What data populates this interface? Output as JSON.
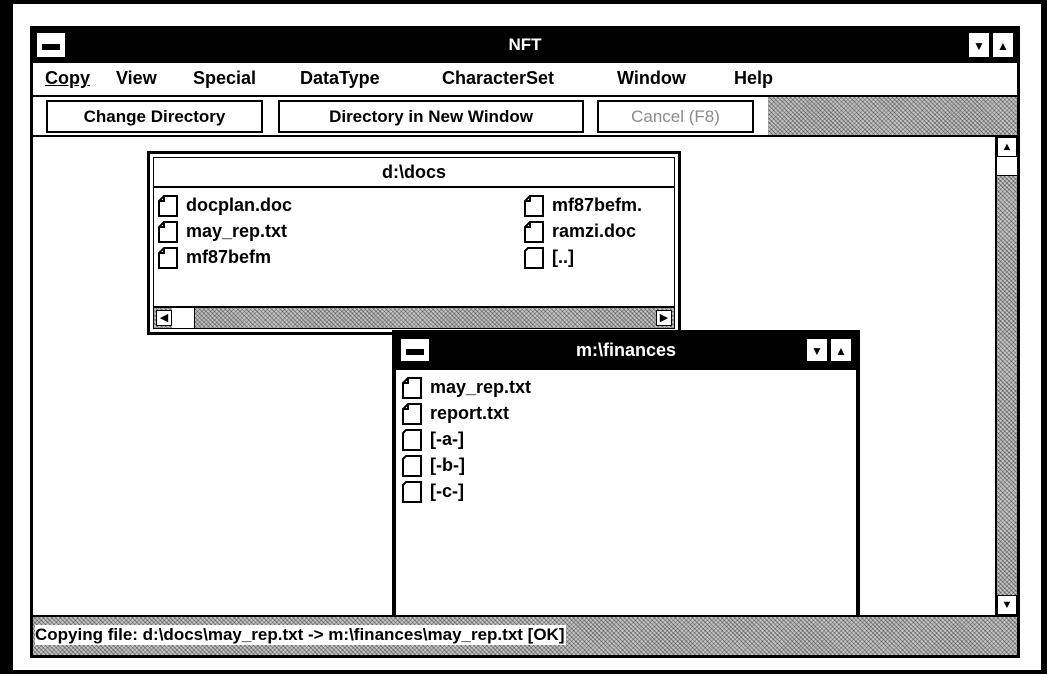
{
  "app": {
    "title": "NFT",
    "menu": [
      "Copy",
      "View",
      "Special",
      "DataType",
      "CharacterSet",
      "Window",
      "Help"
    ],
    "toolbar": {
      "change_directory": "Change Directory",
      "directory_new_window": "Directory in New Window",
      "cancel": "Cancel (F8)"
    },
    "status": "Copying file: d:\\docs\\may_rep.txt -> m:\\finances\\may_rep.txt [OK]"
  },
  "window_docs": {
    "title": "d:\\docs",
    "files_left": [
      "docplan.doc",
      "may_rep.txt",
      "mf87befm"
    ],
    "files_right": [
      "mf87befm.",
      "ramzi.doc",
      "[..]"
    ]
  },
  "window_finances": {
    "title": "m:\\finances",
    "files": [
      "may_rep.txt",
      "report.txt",
      "[-a-]",
      "[-b-]",
      "[-c-]"
    ]
  },
  "icons": {
    "file": "document-icon",
    "folder": "folder-icon",
    "system_menu": "system-menu-icon",
    "minimize": "minimize-icon",
    "maximize": "maximize-icon"
  }
}
